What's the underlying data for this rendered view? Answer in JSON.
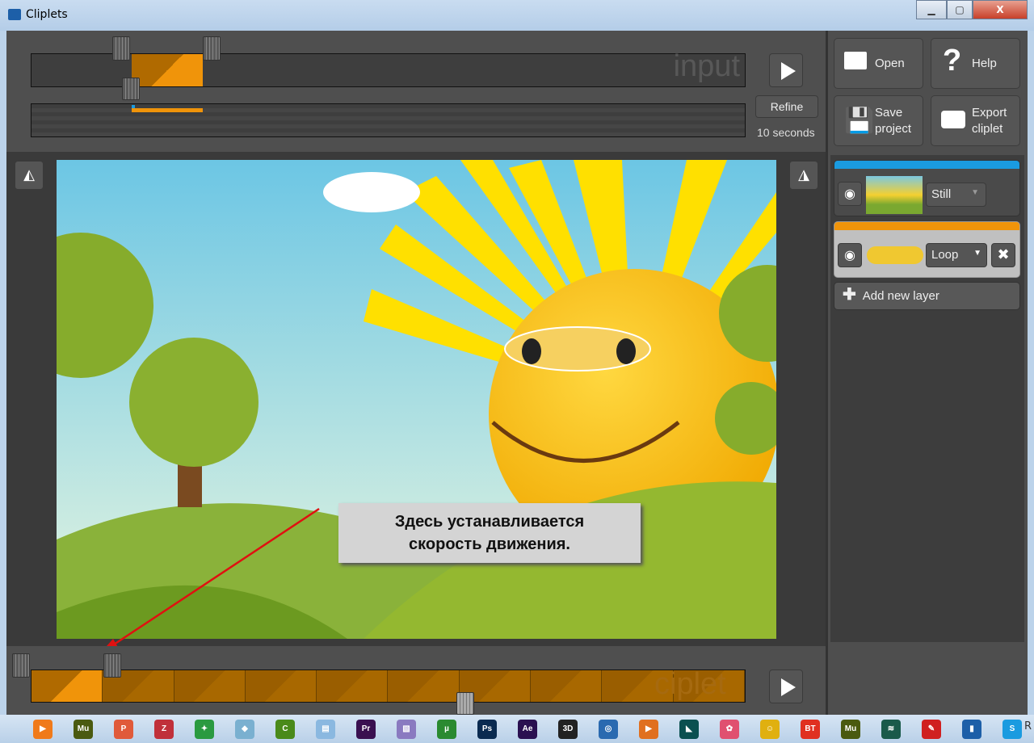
{
  "window": {
    "title": "Cliplets",
    "minimize": "▁",
    "maximize": "▢",
    "close": "X"
  },
  "input": {
    "watermark": "input",
    "refine_label": "Refine",
    "duration": "10 seconds",
    "play": "play-icon"
  },
  "toolbar": {
    "open": "Open",
    "help": "Help",
    "save": "Save project",
    "export": "Export cliplet"
  },
  "layers": [
    {
      "mode": "Still",
      "color": "#1a9be0"
    },
    {
      "mode": "Loop",
      "color": "#f0940a",
      "selected": true
    }
  ],
  "add_layer": "Add new layer",
  "callout": {
    "line1": "Здесь устанавливается",
    "line2": "скорость движения."
  },
  "cliplet": {
    "watermark": "ciplet",
    "segments": 10
  },
  "taskbar": {
    "items": [
      {
        "t": "▶",
        "c": "#f07a1a"
      },
      {
        "t": "Mu",
        "c": "#4a5a10"
      },
      {
        "t": "P",
        "c": "#e05a3a"
      },
      {
        "t": "Z",
        "c": "#c0303a"
      },
      {
        "t": "✦",
        "c": "#2a9a40"
      },
      {
        "t": "◆",
        "c": "#7ab0d0"
      },
      {
        "t": "C",
        "c": "#4a8a1a"
      },
      {
        "t": "▤",
        "c": "#8ab8e0"
      },
      {
        "t": "Pr",
        "c": "#3a1050"
      },
      {
        "t": "▧",
        "c": "#8a7ac0"
      },
      {
        "t": "µ",
        "c": "#2a8a30"
      },
      {
        "t": "Ps",
        "c": "#0a2a50"
      },
      {
        "t": "Ae",
        "c": "#2a1050"
      },
      {
        "t": "3D",
        "c": "#222"
      },
      {
        "t": "◎",
        "c": "#2a6ab0"
      },
      {
        "t": "▶",
        "c": "#e07020"
      },
      {
        "t": "◣",
        "c": "#0a5050"
      },
      {
        "t": "✿",
        "c": "#e05070"
      },
      {
        "t": "☺",
        "c": "#e0b010"
      },
      {
        "t": "BT",
        "c": "#e03020"
      },
      {
        "t": "Mu",
        "c": "#4a5a10"
      },
      {
        "t": "≋",
        "c": "#1a5a4a"
      },
      {
        "t": "✎",
        "c": "#d02020"
      },
      {
        "t": "▮",
        "c": "#1d5fa8"
      },
      {
        "t": "S",
        "c": "#1a9be0"
      }
    ],
    "tray": "R"
  }
}
